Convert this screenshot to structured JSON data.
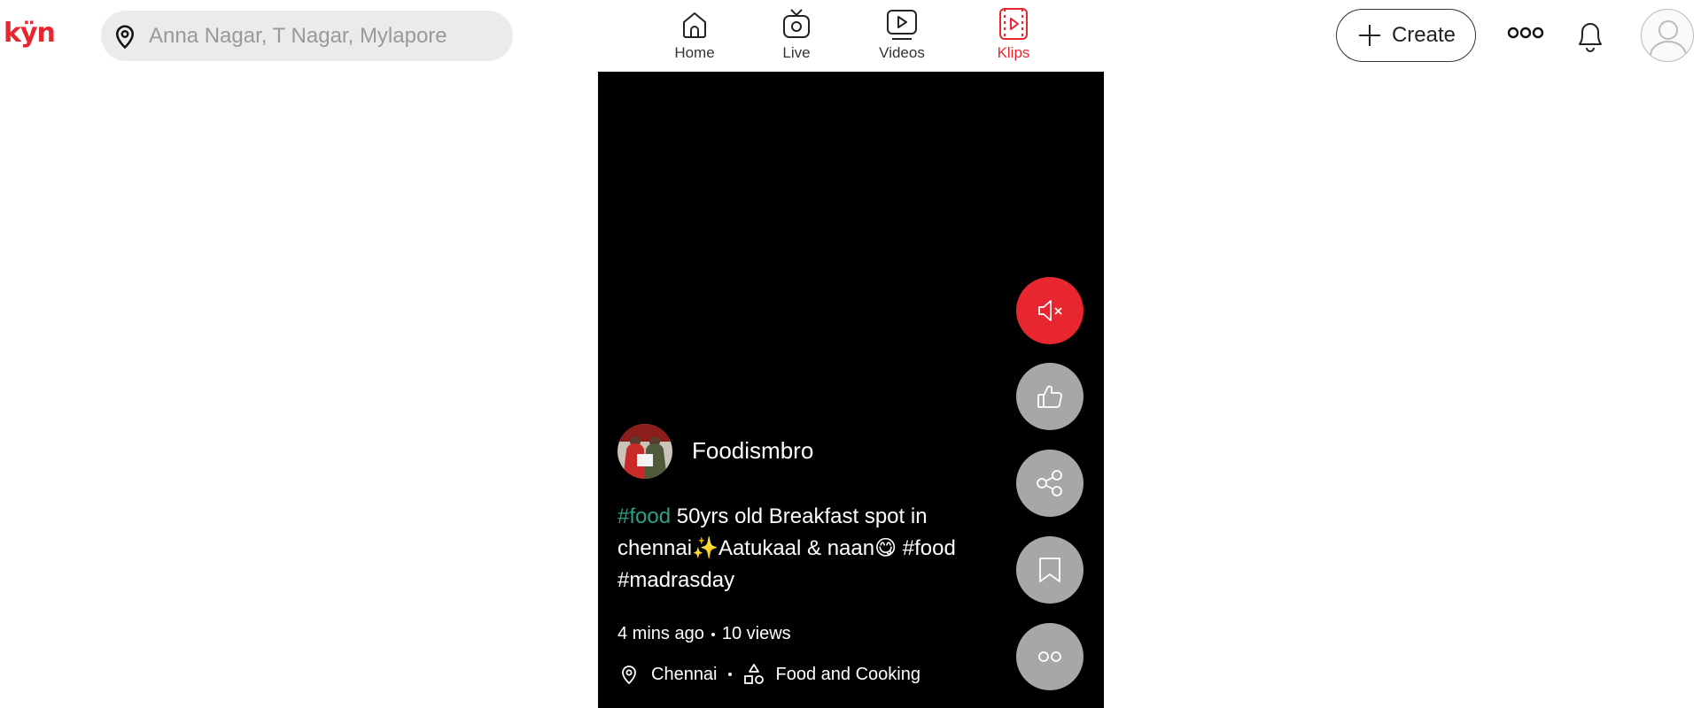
{
  "brand": {
    "logo_text": "kÿn",
    "accent": "#e8262f",
    "tag_color": "#2aa085"
  },
  "search": {
    "placeholder": "Anna Nagar, T Nagar, Mylapore",
    "value": "",
    "icon": "location-pin-icon"
  },
  "nav": [
    {
      "label": "Home",
      "icon": "home-icon",
      "active": false
    },
    {
      "label": "Live",
      "icon": "live-tv-icon",
      "active": false
    },
    {
      "label": "Videos",
      "icon": "video-play-icon",
      "active": false
    },
    {
      "label": "Klips",
      "icon": "klips-icon",
      "active": true
    }
  ],
  "header_actions": {
    "create_label": "Create",
    "more_icon": "more-dots-icon",
    "bell_icon": "bell-icon",
    "avatar_icon": "user-avatar-icon"
  },
  "klip": {
    "author": "Foodismbro",
    "caption": {
      "tag1": "#food",
      "text": "50yrs old Breakfast spot in chennai✨Aatukaal & naan😋 #food #madrasday"
    },
    "time_ago": "4 mins ago",
    "views": "10 views",
    "location": "Chennai",
    "category": "Food and Cooking",
    "actions": [
      "mute-icon",
      "thumbs-up-icon",
      "share-icon",
      "bookmark-icon",
      "more-dots-icon"
    ]
  }
}
